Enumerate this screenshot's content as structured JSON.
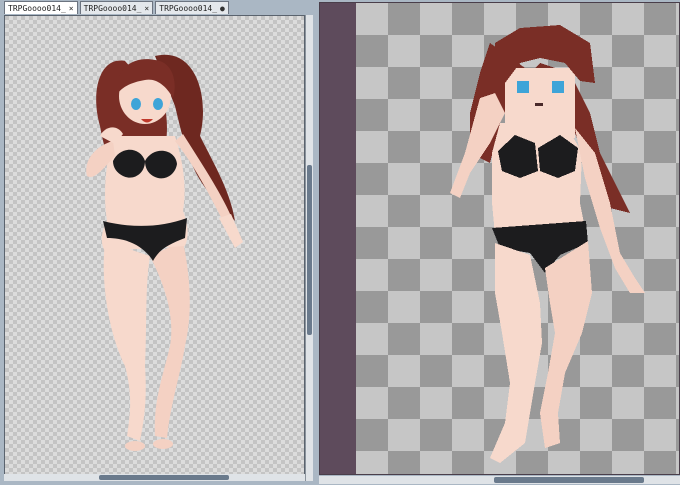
{
  "tabs": [
    {
      "label": "TRPGoooo014_",
      "marker": "×",
      "active": true
    },
    {
      "label": "TRPGoooo014_",
      "marker": "×",
      "active": false
    },
    {
      "label": "TRPGoooo014_",
      "marker": "●",
      "active": false
    }
  ],
  "colors": {
    "app_bg": "#aab7c4",
    "hair": "#7a2e26",
    "skin": "#f7d9cc",
    "lingerie": "#1c1c1e",
    "eyes": "#3ea4d8",
    "right_panel_margin": "#5e4b5c"
  },
  "icons": {
    "close": "close-icon",
    "modified": "unsaved-dot-icon"
  }
}
